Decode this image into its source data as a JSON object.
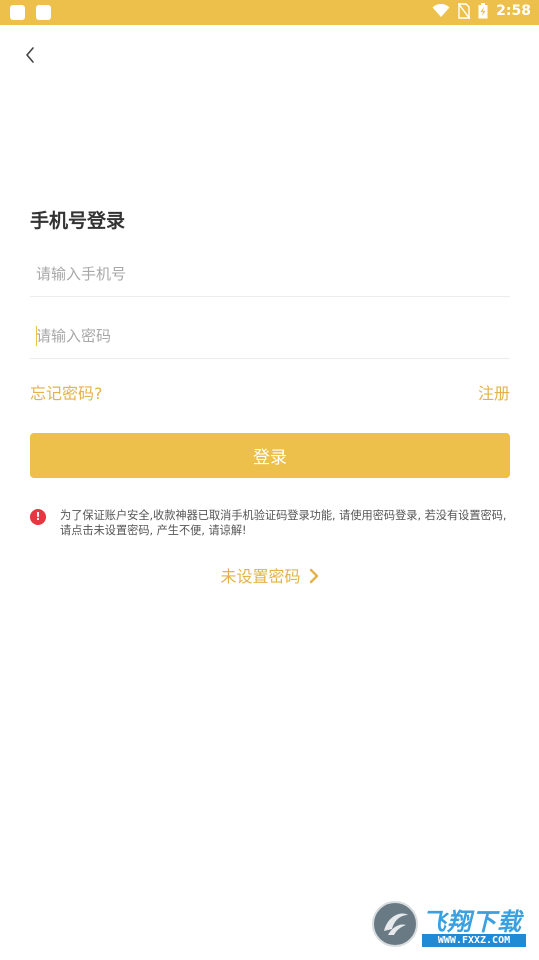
{
  "status_bar": {
    "time": "2:58",
    "icons": [
      "notification-icon",
      "notification-icon",
      "wifi-icon",
      "no-sim-icon",
      "battery-charging-icon"
    ]
  },
  "header": {
    "back_icon": "chevron-left-icon"
  },
  "login": {
    "title": "手机号登录",
    "phone_placeholder": "请输入手机号",
    "phone_value": "",
    "password_placeholder": "请输入密码",
    "password_value": "",
    "forgot_label": "忘记密码?",
    "register_label": "注册",
    "login_button": "登录"
  },
  "notice": {
    "icon": "exclamation-icon",
    "text": "为了保证账户安全,收款神器已取消手机验证码登录功能, 请使用密码登录, 若没有设置密码, 请点击未设置密码, 产生不便, 请谅解!"
  },
  "unset_password": {
    "label": "未设置密码",
    "icon": "chevron-right-icon"
  },
  "watermark": {
    "brand": "飞翔下载",
    "url": "WWW.FXXZ.COM"
  },
  "colors": {
    "accent": "#ecc04a",
    "link": "#e3b34a",
    "warning": "#e5373f",
    "placeholder": "#a8a8a8"
  }
}
